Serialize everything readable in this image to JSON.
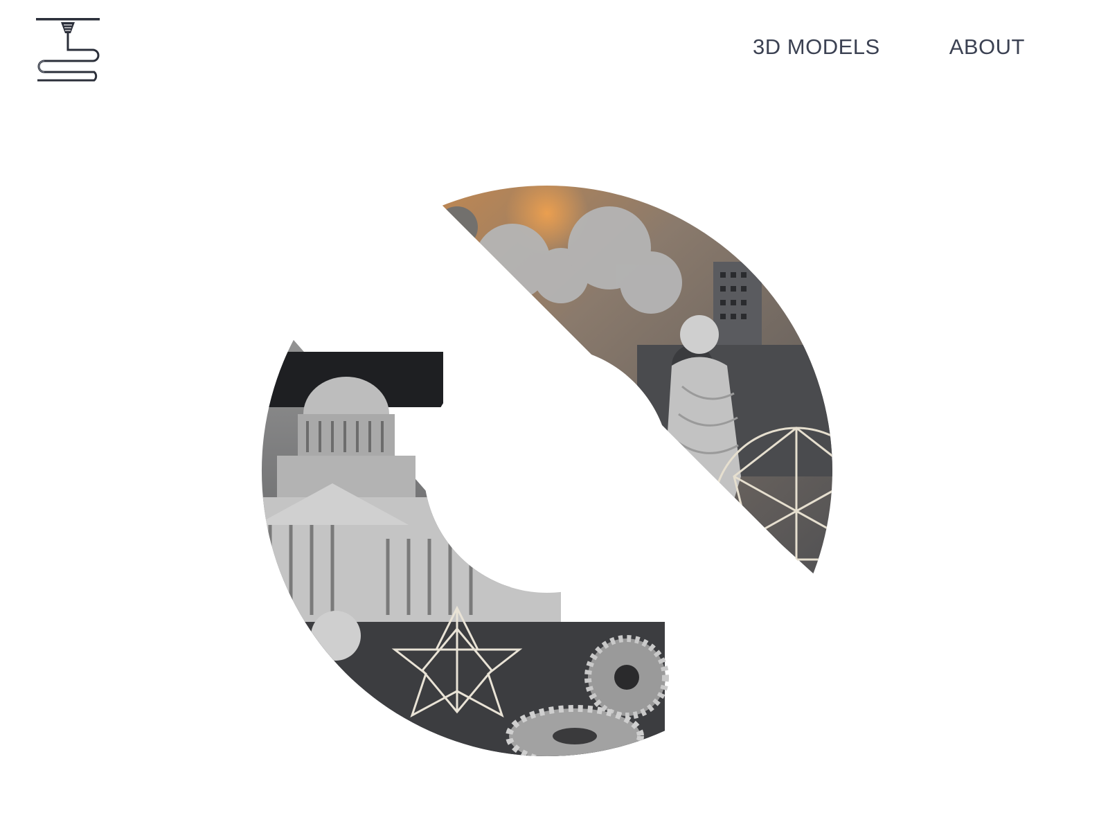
{
  "header": {
    "logo_icon": "3d-printer-nozzle-logo-icon",
    "nav": [
      {
        "label": "3D MODELS"
      },
      {
        "label": "ABOUT"
      }
    ]
  },
  "hero": {
    "graphic": "split-ring-collage",
    "image_description_icon": "3d-printed-models-collage"
  },
  "colors": {
    "background": "#ffffff",
    "nav_text": "#3b4152",
    "logo": "#2b2f3a"
  }
}
